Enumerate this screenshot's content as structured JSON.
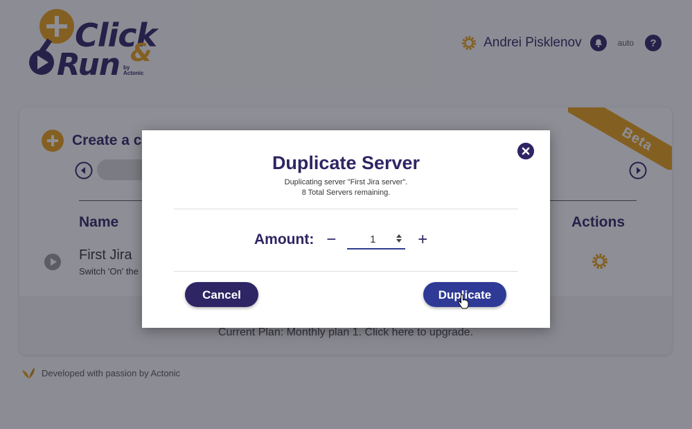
{
  "header": {
    "logo": {
      "word1": "Click",
      "amp": "&",
      "word2": "Run",
      "by": "by",
      "company": "Actonic"
    },
    "user_name": "Andrei Pisklenov",
    "auto_label": "auto",
    "icons": [
      "gear-icon",
      "bell-icon",
      "help-icon"
    ]
  },
  "card": {
    "create_title": "Create a c",
    "ribbon": "Beta",
    "columns": {
      "name": "Name",
      "actions": "Actions"
    },
    "row": {
      "name": "First Jira",
      "subtitle": "Switch 'On' the"
    },
    "plan_text": "Current Plan: Monthly plan 1. Click here to upgrade."
  },
  "footer": {
    "text": "Developed with passion by Actonic"
  },
  "modal": {
    "title": "Duplicate Server",
    "subtitle_line1": "Duplicating server \"First Jira server\".",
    "subtitle_line2": "8 Total Servers remaining.",
    "amount_label": "Amount:",
    "amount_value": "1",
    "minus": "−",
    "plus": "+",
    "cancel_label": "Cancel",
    "duplicate_label": "Duplicate"
  },
  "colors": {
    "primary": "#2e2564",
    "accent": "#e8a317",
    "button_blue": "#2f3a96"
  }
}
